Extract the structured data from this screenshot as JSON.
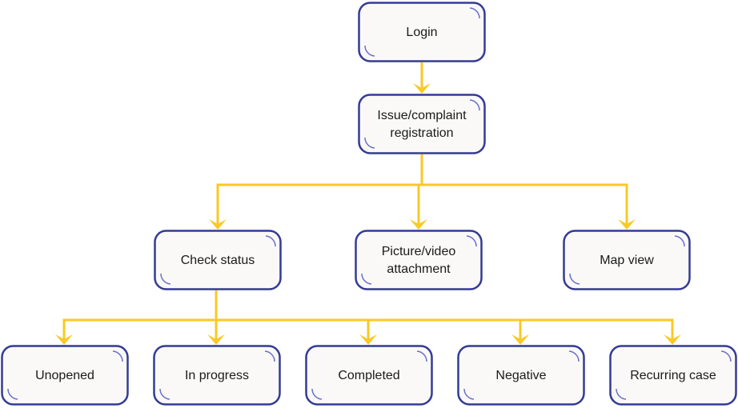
{
  "colors": {
    "box_stroke": "#343b94",
    "box_fill": "#faf9f8",
    "corner_arc": "#6a70c8",
    "connector": "#f9c925",
    "text": "#1a1a1a"
  },
  "nodes": {
    "login": {
      "lines": [
        "Login"
      ]
    },
    "registration": {
      "lines": [
        "Issue/complaint",
        "registration"
      ]
    },
    "check_status": {
      "lines": [
        "Check status"
      ]
    },
    "attachment": {
      "lines": [
        "Picture/video",
        "attachment"
      ]
    },
    "map_view": {
      "lines": [
        "Map view"
      ]
    },
    "unopened": {
      "lines": [
        "Unopened"
      ]
    },
    "in_progress": {
      "lines": [
        "In progress"
      ]
    },
    "completed": {
      "lines": [
        "Completed"
      ]
    },
    "negative": {
      "lines": [
        "Negative"
      ]
    },
    "recurring": {
      "lines": [
        "Recurring case"
      ]
    }
  },
  "edges": [
    [
      "login",
      "registration"
    ],
    [
      "registration",
      "check_status"
    ],
    [
      "registration",
      "attachment"
    ],
    [
      "registration",
      "map_view"
    ],
    [
      "check_status",
      "unopened"
    ],
    [
      "check_status",
      "in_progress"
    ],
    [
      "check_status",
      "completed"
    ],
    [
      "check_status",
      "negative"
    ],
    [
      "check_status",
      "recurring"
    ]
  ]
}
